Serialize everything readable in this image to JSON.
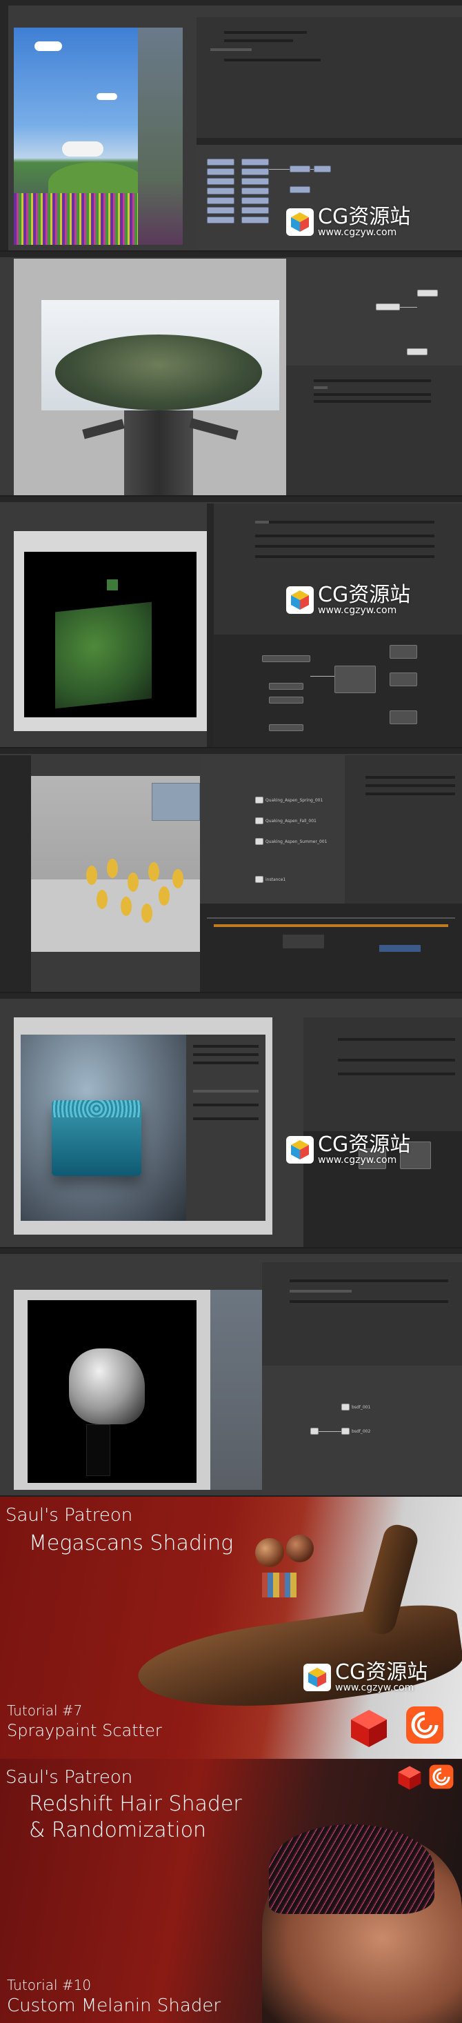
{
  "watermark": {
    "title": "CG资源站",
    "url": "www.cgzyw.com"
  },
  "colors": {
    "houdini_bg": "#3a3a3a",
    "node_blue": "#9aa9c9",
    "banner_red": "#8a1a12",
    "redshift_red": "#e0281f",
    "houdini_orange": "#ff5a1e"
  },
  "panel4": {
    "nodes": [
      "Quaking_Aspen_Spring_001",
      "Quaking_Aspen_Fall_001",
      "Quaking_Aspen_Summer_001",
      "instance1"
    ]
  },
  "panel6": {
    "nodes": [
      "bsdf_001",
      "bsdf_002"
    ]
  },
  "banner1": {
    "line1": "Saul's Patreon",
    "line2": "Megascans Shading",
    "tutorial": "Tutorial #7",
    "subtitle": "Spraypaint Scatter"
  },
  "banner2": {
    "line1": "Saul's Patreon",
    "line2": "Redshift Hair Shader",
    "line3": "& Randomization",
    "tutorial": "Tutorial #10",
    "subtitle": "Custom Melanin Shader"
  },
  "icons": [
    "redshift-icon",
    "houdini-icon",
    "cg-logo-icon"
  ]
}
